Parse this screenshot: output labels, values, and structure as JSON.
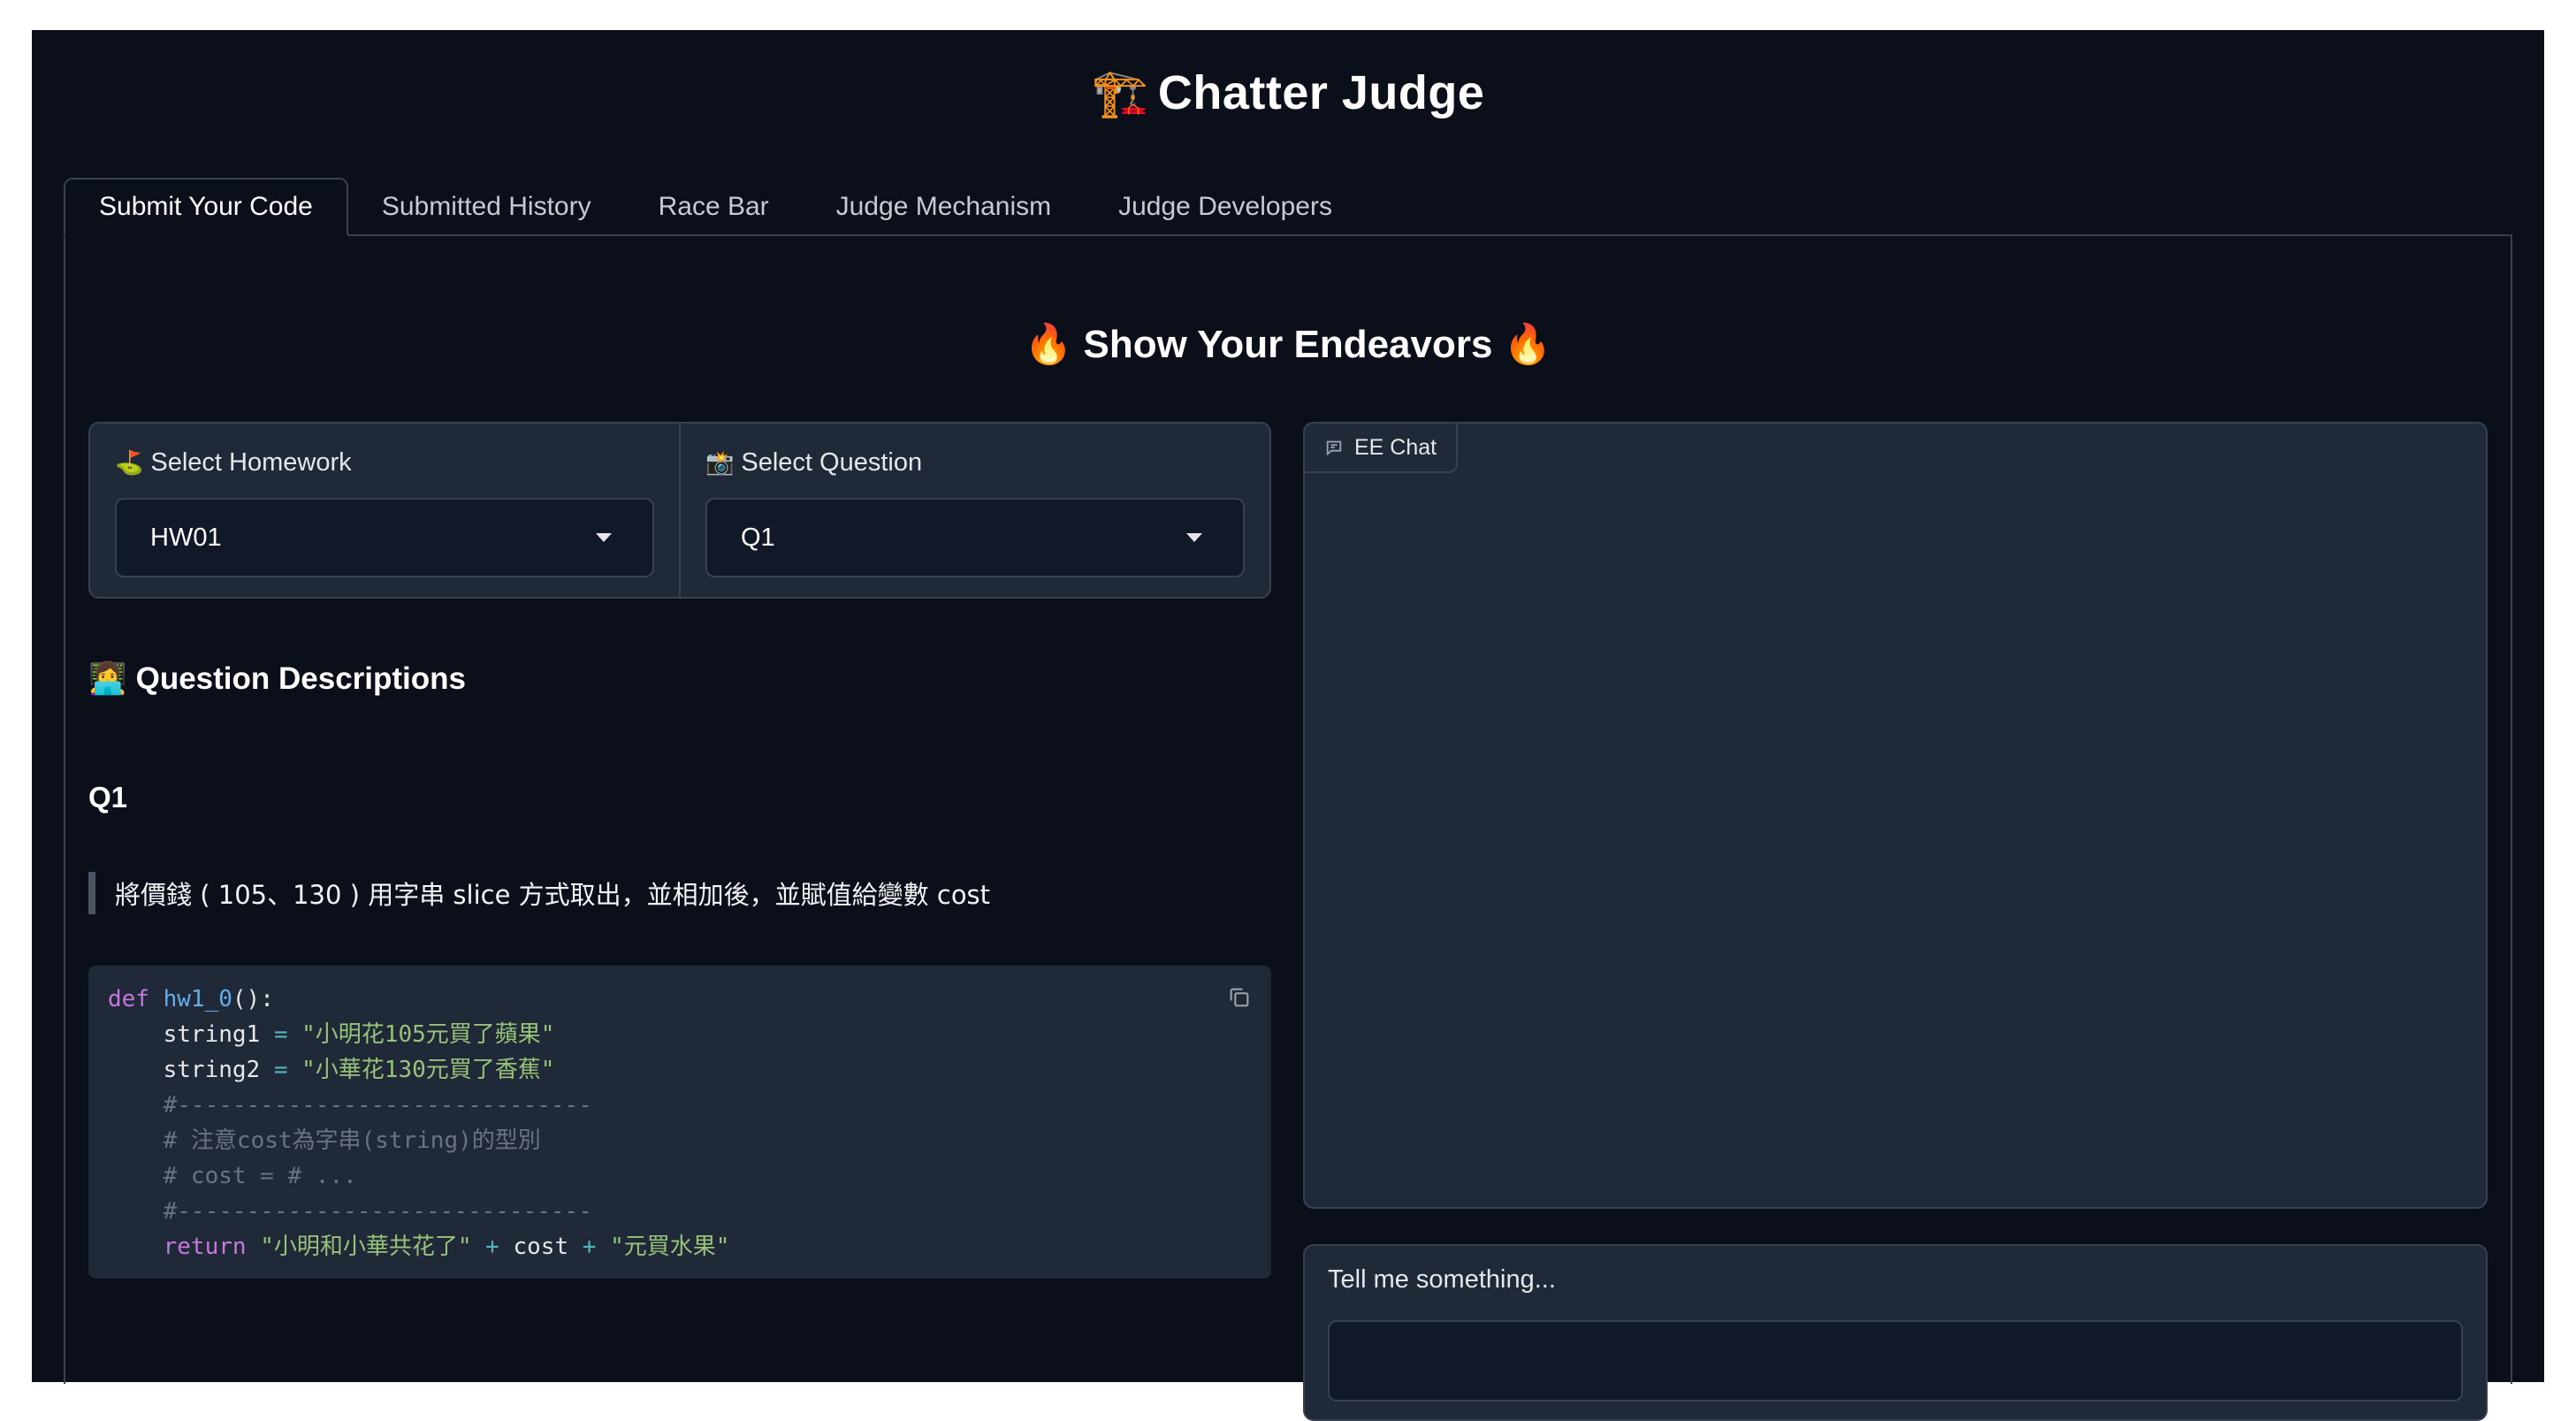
{
  "app": {
    "title": "Chatter Judge",
    "title_icon": "🏗️"
  },
  "tabs": [
    {
      "label": "Submit Your Code",
      "active": true
    },
    {
      "label": "Submitted History",
      "active": false
    },
    {
      "label": "Race Bar",
      "active": false
    },
    {
      "label": "Judge Mechanism",
      "active": false
    },
    {
      "label": "Judge Developers",
      "active": false
    }
  ],
  "main": {
    "section_title": "Show Your Endeavors",
    "section_icon": "🔥",
    "homework": {
      "label": "Select Homework",
      "icon": "⛳",
      "value": "HW01"
    },
    "question": {
      "label": "Select Question",
      "icon": "📸",
      "value": "Q1"
    },
    "descriptions": {
      "heading": "Question Descriptions",
      "icon": "👩‍💻",
      "question_title": "Q1",
      "quote": "將價錢 ( 105、130 ) 用字串 slice 方式取出，並相加後，並賦值給變數 cost"
    },
    "code": {
      "lines": [
        "def hw1_0():",
        "    string1 = \"小明花105元買了蘋果\"",
        "    string2 = \"小華花130元買了香蕉\"",
        "    #------------------------------",
        "    # 注意cost為字串(string)的型別",
        "    # cost = # ...",
        "    #------------------------------",
        "    return \"小明和小華共花了\" + cost + \"元買水果\""
      ]
    }
  },
  "chat": {
    "label": "EE Chat",
    "icon": "chat-icon"
  },
  "input": {
    "label": "Tell me something...",
    "value": "",
    "placeholder": ""
  },
  "colors": {
    "background": "#0b0f19",
    "panel": "#1f2937",
    "border": "#374151"
  }
}
